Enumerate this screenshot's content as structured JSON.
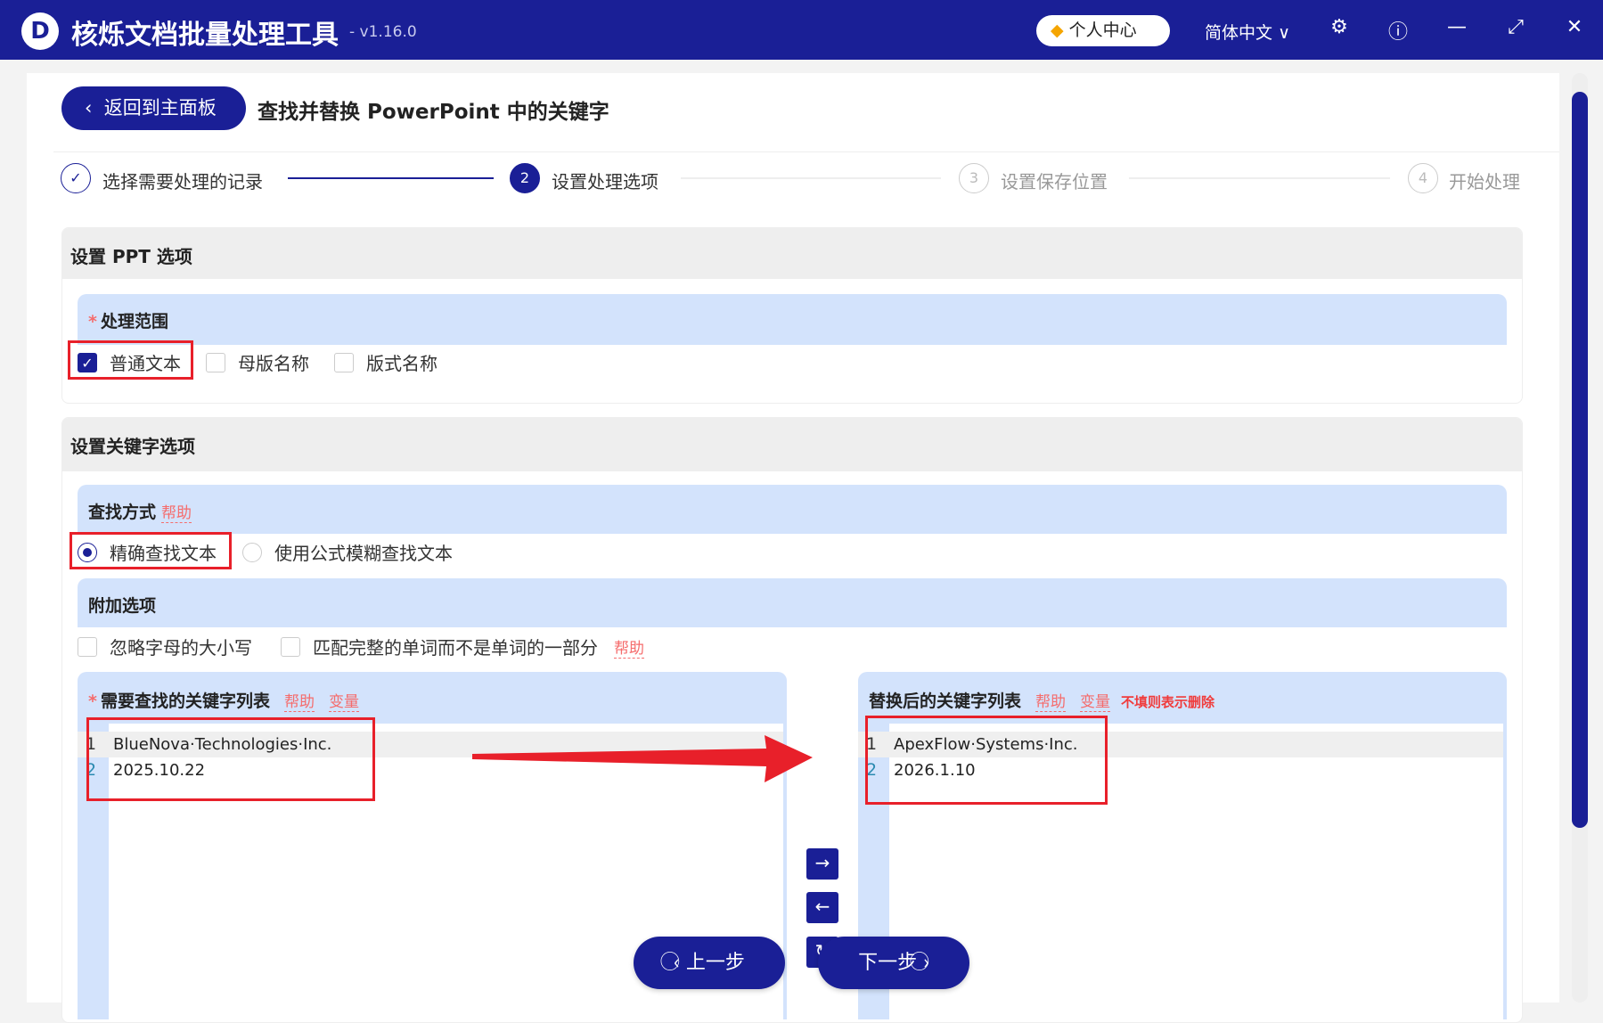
{
  "app": {
    "logo": "D",
    "name": "核烁文档批量处理工具",
    "version": "- v1.16.0",
    "user_center": "个人中心",
    "language": "简体中文",
    "icons": [
      "gem-icon",
      "chevron-down-icon",
      "gear-icon",
      "help-icon",
      "minimize-icon",
      "maximize-icon",
      "close-icon"
    ]
  },
  "header": {
    "back": "返回到主面板",
    "title": "查找并替换 PowerPoint 中的关键字"
  },
  "steps": [
    {
      "num": "✓",
      "label": "选择需要处理的记录"
    },
    {
      "num": "2",
      "label": "设置处理选项"
    },
    {
      "num": "3",
      "label": "设置保存位置"
    },
    {
      "num": "4",
      "label": "开始处理"
    }
  ],
  "ppt": {
    "title": "设置 PPT 选项",
    "scope_label": "处理范围",
    "scope_options": [
      {
        "label": "普通文本",
        "checked": true
      },
      {
        "label": "母版名称",
        "checked": false
      },
      {
        "label": "版式名称",
        "checked": false
      }
    ]
  },
  "keyword": {
    "title": "设置关键字选项",
    "find_mode_label": "查找方式",
    "help": "帮助",
    "modes": [
      {
        "label": "精确查找文本",
        "selected": true
      },
      {
        "label": "使用公式模糊查找文本",
        "selected": false
      }
    ],
    "extra_label": "附加选项",
    "extras": [
      {
        "label": "忽略字母的大小写",
        "checked": false
      },
      {
        "label": "匹配完整的单词而不是单词的一部分",
        "checked": false
      }
    ],
    "find_list": {
      "label": "需要查找的关键字列表",
      "help": "帮助",
      "var": "变量",
      "lines": [
        "BlueNova·Technologies·Inc.",
        "2025.10.22"
      ]
    },
    "replace_list": {
      "label": "替换后的关键字列表",
      "help": "帮助",
      "var": "变量",
      "note": "不填则表示删除",
      "lines": [
        "ApexFlow·Systems·Inc.",
        "2026.1.10"
      ]
    }
  },
  "nav": {
    "prev": "上一步",
    "next": "下一步"
  },
  "colors": {
    "primary": "#1a1f96",
    "highlight": "#e8202a",
    "help": "#f56c6c"
  }
}
